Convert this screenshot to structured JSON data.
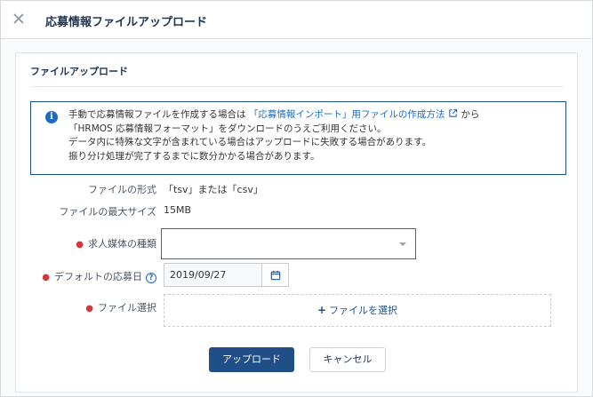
{
  "header": {
    "title": "応募情報ファイルアップロード",
    "close_icon": "close-icon"
  },
  "panel": {
    "title": "ファイルアップロード"
  },
  "info": {
    "icon": "info-icon",
    "line1_prefix": "手動で応募情報ファイルを作成する場合は",
    "line1_link": "「応募情報インポート」用ファイルの作成方法",
    "line1_suffix": "から",
    "line2": "「HRMOS 応募情報フォーマット」をダウンロードのうえご利用ください。",
    "line3": "データ内に特殊な文字が含まれている場合はアップロードに失敗する場合があります。",
    "line4": "振り分け処理が完了するまでに数分かかる場合があります。"
  },
  "fields": {
    "format_label": "ファイルの形式",
    "format_value": "「tsv」または「csv」",
    "max_size_label": "ファイルの最大サイズ",
    "max_size_value": "15MB",
    "media_type_label": "求人媒体の種類",
    "media_type_value": "",
    "default_date_label": "デフォルトの応募日",
    "default_date_value": "2019/09/27",
    "file_select_label": "ファイル選択",
    "file_select_button": "ファイルを選択"
  },
  "buttons": {
    "upload": "アップロード",
    "cancel": "キャンセル"
  },
  "colors": {
    "accent": "#1f4f86",
    "link": "#1d6bc2",
    "required": "#d13a3a",
    "error_border": "#e02a2a"
  }
}
